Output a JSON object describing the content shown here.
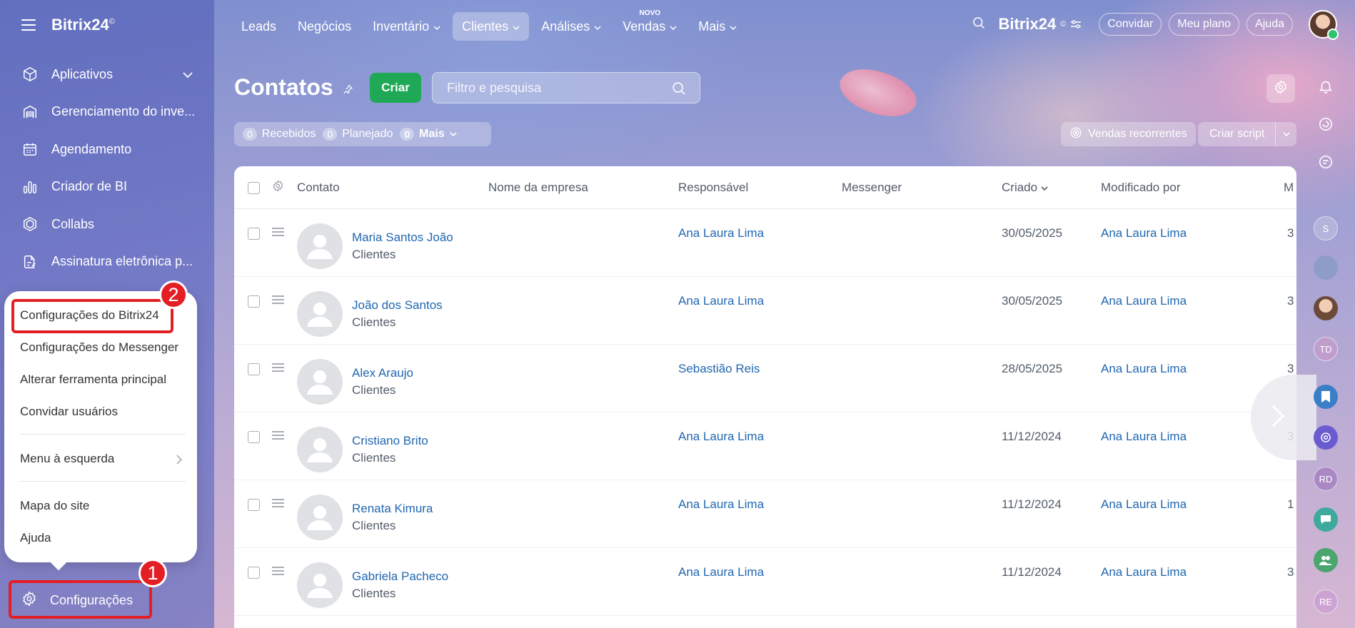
{
  "sidebar": {
    "brand": "Bitrix24",
    "brand_mark": "©",
    "items": [
      {
        "label": "Aplicativos",
        "icon": "cube-icon"
      },
      {
        "label": "Gerenciamento do inve...",
        "icon": "warehouse-icon"
      },
      {
        "label": "Agendamento",
        "icon": "calendar-icon"
      },
      {
        "label": "Criador de BI",
        "icon": "bar-chart-icon"
      },
      {
        "label": "Collabs",
        "icon": "hexagon-icon"
      },
      {
        "label": "Assinatura eletrônica p...",
        "icon": "signature-icon"
      }
    ],
    "settings_label": "Configurações"
  },
  "popup": {
    "items": [
      "Configurações do Bitrix24",
      "Configurações do Messenger",
      "Alterar ferramenta principal",
      "Convidar usuários",
      "Menu à esquerda",
      "Mapa do site",
      "Ajuda"
    ]
  },
  "annotations": {
    "badge1": "1",
    "badge2": "2"
  },
  "topnav": {
    "items": [
      {
        "label": "Leads"
      },
      {
        "label": "Negócios"
      },
      {
        "label": "Inventário"
      },
      {
        "label": "Clientes"
      },
      {
        "label": "Análises"
      },
      {
        "label": "Vendas",
        "tag": "NOVO"
      },
      {
        "label": "Mais"
      }
    ],
    "brand": "Bitrix24",
    "brand_mark": "©",
    "invite": "Convidar",
    "plan": "Meu plano",
    "help": "Ajuda"
  },
  "page": {
    "title": "Contatos",
    "create": "Criar",
    "search_placeholder": "Filtro e pesquisa",
    "counters": [
      {
        "num": "0",
        "label": "Recebidos"
      },
      {
        "num": "0",
        "label": "Planejado"
      },
      {
        "num": "0",
        "label": "Mais"
      }
    ],
    "recurring": "Vendas recorrentes",
    "script": "Criar script"
  },
  "table": {
    "headers": {
      "contact": "Contato",
      "company": "Nome da empresa",
      "responsible": "Responsável",
      "messenger": "Messenger",
      "created": "Criado",
      "modified_by": "Modificado por",
      "more": "M"
    },
    "rows": [
      {
        "name": "Maria Santos João",
        "type": "Clientes",
        "responsible": "Ana Laura Lima",
        "created": "30/05/2025",
        "modified_by": "Ana Laura Lima",
        "extra": "3"
      },
      {
        "name": "João dos Santos",
        "type": "Clientes",
        "responsible": "Ana Laura Lima",
        "created": "30/05/2025",
        "modified_by": "Ana Laura Lima",
        "extra": "3"
      },
      {
        "name": "Alex Araujo",
        "type": "Clientes",
        "responsible": "Sebastião Reis",
        "created": "28/05/2025",
        "modified_by": "Ana Laura Lima",
        "extra": "3"
      },
      {
        "name": "Cristiano Brito",
        "type": "Clientes",
        "responsible": "Ana Laura Lima",
        "created": "11/12/2024",
        "modified_by": "Ana Laura Lima",
        "extra": "3"
      },
      {
        "name": "Renata Kimura",
        "type": "Clientes",
        "responsible": "Ana Laura Lima",
        "created": "11/12/2024",
        "modified_by": "Ana Laura Lima",
        "extra": "1"
      },
      {
        "name": "Gabriela Pacheco",
        "type": "Clientes",
        "responsible": "Ana Laura Lima",
        "created": "11/12/2024",
        "modified_by": "Ana Laura Lima",
        "extra": "3"
      }
    ]
  },
  "right_rail": {
    "initials": [
      "S",
      "TD",
      "RD",
      "RE"
    ]
  },
  "colors": {
    "accent_green": "#1fa855",
    "link_blue": "#2067b0",
    "annotation_red": "#e31e24"
  }
}
